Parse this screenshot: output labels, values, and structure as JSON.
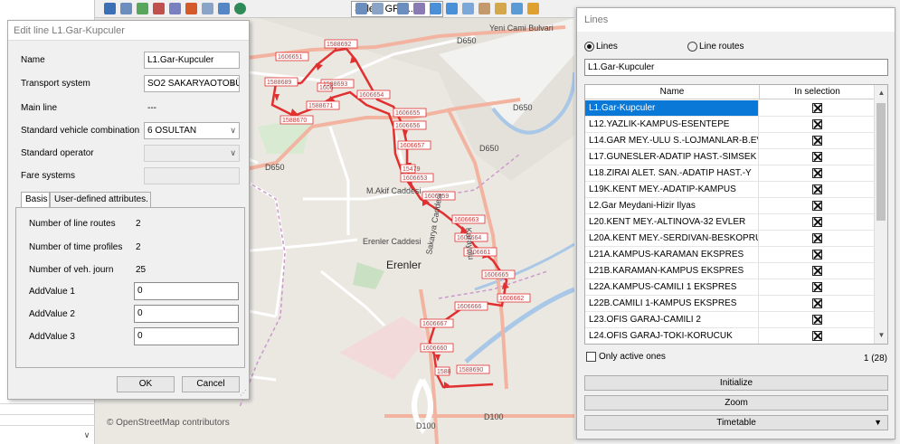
{
  "toolbar": {
    "select_value": "Select GPar..."
  },
  "map": {
    "attribution": "© OpenStreetMap contributors",
    "place_label": "Erenler",
    "road_labels": [
      "D650",
      "D650",
      "D650",
      "D650",
      "D100",
      "D100",
      "Yeni Cami Bulvari",
      "M.Akif Caddesi",
      "Erenler Caddesi",
      "Sakarya Caddesi",
      "Karayolu"
    ],
    "stop_labels": [
      "1588692",
      "1606651",
      "1588693",
      "1588689",
      "1606664",
      "1588671",
      "1606654",
      "1588670",
      "1606655",
      "1606656",
      "1606657",
      "1606653",
      "1606659",
      "1606663",
      "1606664",
      "1606661",
      "1606665",
      "1606662",
      "1606666",
      "1606667",
      "1606660",
      "1588690"
    ]
  },
  "edit_dialog": {
    "title": "Edit line L1.Gar-Kupculer",
    "fields": {
      "name_label": "Name",
      "name_value": "L1.Gar-Kupculer",
      "ts_label": "Transport system",
      "ts_value": "SO2 SAKARYAOTOBÜ",
      "main_label": "Main line",
      "main_value": "---",
      "svc_label": "Standard vehicle combination",
      "svc_value": "6 OSULTAN",
      "op_label": "Standard operator",
      "op_value": "",
      "fare_label": "Fare systems",
      "fare_value": ""
    },
    "tabs": {
      "basis": "Basis",
      "uda": "User-defined attributes."
    },
    "panel": {
      "routes_label": "Number of line routes",
      "routes_value": "2",
      "profiles_label": "Number of time profiles",
      "profiles_value": "2",
      "journ_label": "Number of veh. journ",
      "journ_value": "25",
      "av1_label": "AddValue 1",
      "av1_value": "0",
      "av2_label": "AddValue 2",
      "av2_value": "0",
      "av3_label": "AddValue 3",
      "av3_value": "0"
    },
    "ok": "OK",
    "cancel": "Cancel"
  },
  "lines_dialog": {
    "title": "Lines",
    "radio_lines": "Lines",
    "radio_routes": "Line routes",
    "filter_value": "L1.Gar-Kupculer",
    "col_name": "Name",
    "col_sel": "In selection",
    "rows": [
      {
        "name": "L1.Gar-Kupculer",
        "selected": true
      },
      {
        "name": "L12.YAZLIK-KAMPUS-ESENTEPE",
        "selected": false
      },
      {
        "name": "L14.GAR MEY.-ULU S.-LOJMANLAR-B.EV",
        "selected": false
      },
      {
        "name": "L17.GUNESLER-ADATIP HAST.-SIMSEK",
        "selected": false
      },
      {
        "name": "L18.ZIRAI ALET. SAN.-ADATIP HAST.-Y",
        "selected": false
      },
      {
        "name": "L19K.KENT MEY.-ADATIP-KAMPUS",
        "selected": false
      },
      {
        "name": "L2.Gar Meydani-Hizir Ilyas",
        "selected": false
      },
      {
        "name": "L20.KENT MEY.-ALTINOVA-32 EVLER",
        "selected": false
      },
      {
        "name": "L20A.KENT MEY.-SERDIVAN-BESKOPRU",
        "selected": false
      },
      {
        "name": "L21A.KAMPUS-KARAMAN EKSPRES",
        "selected": false
      },
      {
        "name": "L21B.KARAMAN-KAMPUS EKSPRES",
        "selected": false
      },
      {
        "name": "L22A.KAMPUS-CAMILI 1 EKSPRES",
        "selected": false
      },
      {
        "name": "L22B.CAMILI 1-KAMPUS EKSPRES",
        "selected": false
      },
      {
        "name": "L23.OFIS GARAJ-CAMILI 2",
        "selected": false
      },
      {
        "name": "L24.OFIS GARAJ-TOKI-KORUCUK",
        "selected": false
      }
    ],
    "only_active": "Only active ones",
    "count": "1 (28)",
    "initialize": "Initialize",
    "zoom": "Zoom",
    "timetable": "Timetable"
  }
}
